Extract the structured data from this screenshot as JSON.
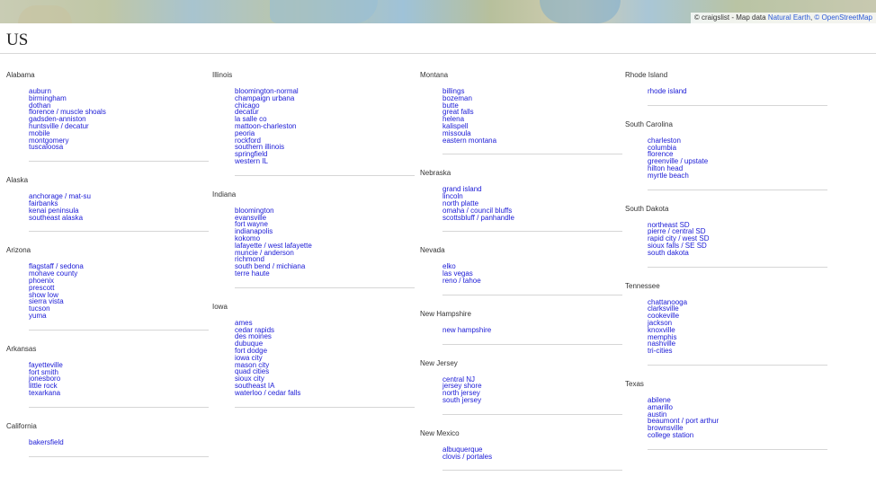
{
  "map": {
    "attribution_prefix": "© craigslist - Map data ",
    "natural_earth": "Natural Earth",
    "comma": ", ",
    "osm": "© OpenStreetMap"
  },
  "title": "US",
  "columns": [
    [
      {
        "name": "Alabama",
        "cities": [
          "auburn",
          "birmingham",
          "dothan",
          "florence / muscle shoals",
          "gadsden-anniston",
          "huntsville / decatur",
          "mobile",
          "montgomery",
          "tuscaloosa"
        ]
      },
      {
        "name": "Alaska",
        "cities": [
          "anchorage / mat-su",
          "fairbanks",
          "kenai peninsula",
          "southeast alaska"
        ]
      },
      {
        "name": "Arizona",
        "cities": [
          "flagstaff / sedona",
          "mohave county",
          "phoenix",
          "prescott",
          "show low",
          "sierra vista",
          "tucson",
          "yuma"
        ]
      },
      {
        "name": "Arkansas",
        "cities": [
          "fayetteville",
          "fort smith",
          "jonesboro",
          "little rock",
          "texarkana"
        ]
      },
      {
        "name": "California",
        "cities": [
          "bakersfield"
        ]
      }
    ],
    [
      {
        "name": "Illinois",
        "cities": [
          "bloomington-normal",
          "champaign urbana",
          "chicago",
          "decatur",
          "la salle co",
          "mattoon-charleston",
          "peoria",
          "rockford",
          "southern illinois",
          "springfield",
          "western IL"
        ]
      },
      {
        "name": "Indiana",
        "cities": [
          "bloomington",
          "evansville",
          "fort wayne",
          "indianapolis",
          "kokomo",
          "lafayette / west lafayette",
          "muncie / anderson",
          "richmond",
          "south bend / michiana",
          "terre haute"
        ]
      },
      {
        "name": "Iowa",
        "cities": [
          "ames",
          "cedar rapids",
          "des moines",
          "dubuque",
          "fort dodge",
          "iowa city",
          "mason city",
          "quad cities",
          "sioux city",
          "southeast IA",
          "waterloo / cedar falls"
        ]
      }
    ],
    [
      {
        "name": "Montana",
        "cities": [
          "billings",
          "bozeman",
          "butte",
          "great falls",
          "helena",
          "kalispell",
          "missoula",
          "eastern montana"
        ]
      },
      {
        "name": "Nebraska",
        "cities": [
          "grand island",
          "lincoln",
          "north platte",
          "omaha / council bluffs",
          "scottsbluff / panhandle"
        ]
      },
      {
        "name": "Nevada",
        "cities": [
          "elko",
          "las vegas",
          "reno / tahoe"
        ]
      },
      {
        "name": "New Hampshire",
        "cities": [
          "new hampshire"
        ]
      },
      {
        "name": "New Jersey",
        "cities": [
          "central NJ",
          "jersey shore",
          "north jersey",
          "south jersey"
        ]
      },
      {
        "name": "New Mexico",
        "cities": [
          "albuquerque",
          "clovis / portales"
        ]
      }
    ],
    [
      {
        "name": "Rhode Island",
        "cities": [
          "rhode island"
        ]
      },
      {
        "name": "South Carolina",
        "cities": [
          "charleston",
          "columbia",
          "florence",
          "greenville / upstate",
          "hilton head",
          "myrtle beach"
        ]
      },
      {
        "name": "South Dakota",
        "cities": [
          "northeast SD",
          "pierre / central SD",
          "rapid city / west SD",
          "sioux falls / SE SD",
          "south dakota"
        ]
      },
      {
        "name": "Tennessee",
        "cities": [
          "chattanooga",
          "clarksville",
          "cookeville",
          "jackson",
          "knoxville",
          "memphis",
          "nashville",
          "tri-cities"
        ]
      },
      {
        "name": "Texas",
        "cities": [
          "abilene",
          "amarillo",
          "austin",
          "beaumont / port arthur",
          "brownsville",
          "college station"
        ]
      }
    ]
  ]
}
